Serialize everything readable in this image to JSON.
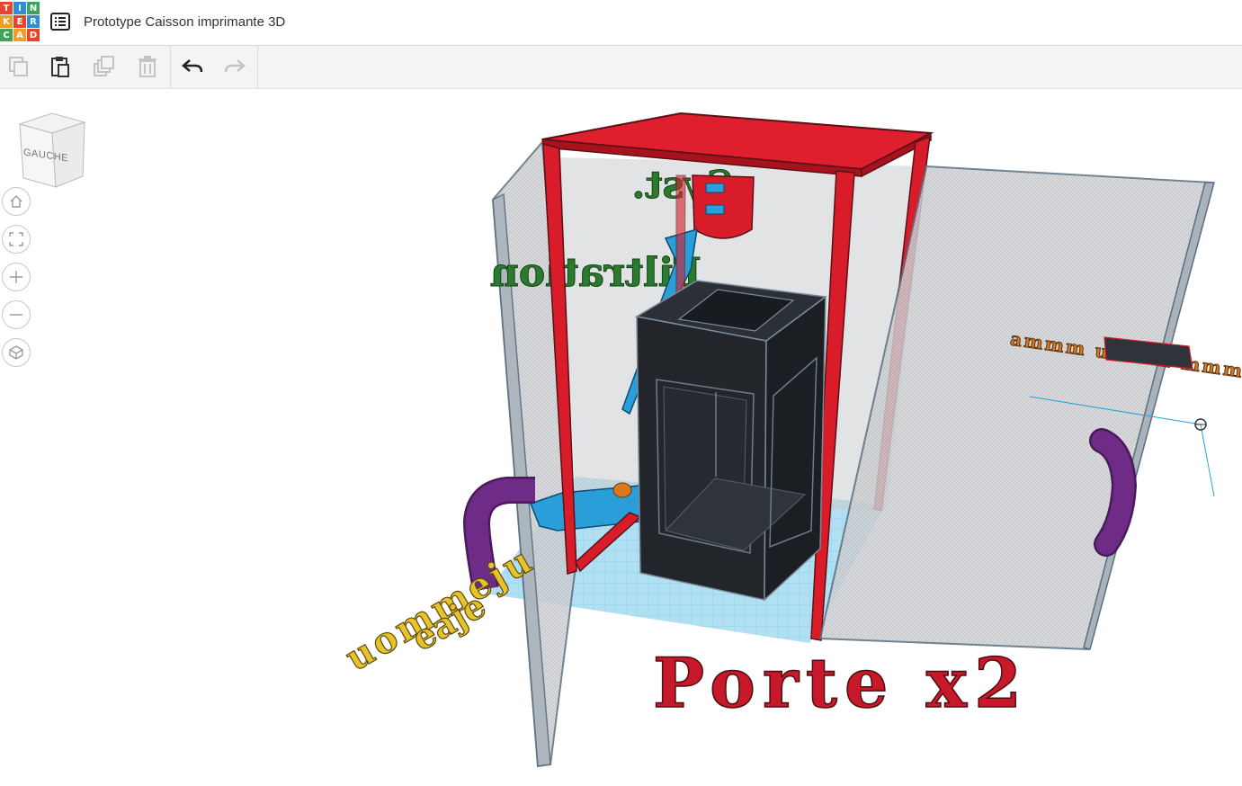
{
  "app": {
    "logo_letters": [
      "T",
      "I",
      "N",
      "K",
      "E",
      "R",
      "C",
      "A",
      "D"
    ],
    "logo_colors": [
      "#e8442d",
      "#2c8fd6",
      "#40a35a",
      "#f39c1f",
      "#e8442d",
      "#2c8fd6",
      "#40a35a",
      "#f39c1f",
      "#e8442d"
    ],
    "project_title": "Prototype Caisson imprimante 3D"
  },
  "toolbar": {
    "buttons": [
      {
        "name": "copy",
        "icon": "copy-icon",
        "enabled": false
      },
      {
        "name": "paste",
        "icon": "paste-icon",
        "enabled": true
      },
      {
        "name": "duplicate",
        "icon": "duplicate-icon",
        "enabled": false
      },
      {
        "name": "delete",
        "icon": "trash-icon",
        "enabled": false
      },
      {
        "name": "undo",
        "icon": "undo-icon",
        "enabled": true
      },
      {
        "name": "redo",
        "icon": "redo-icon",
        "enabled": false
      }
    ]
  },
  "viewcube": {
    "face_label": "GAUCHE"
  },
  "nav_controls": [
    {
      "name": "home-view",
      "icon": "home-icon"
    },
    {
      "name": "fit-view",
      "icon": "fit-view-icon"
    },
    {
      "name": "zoom-in",
      "icon": "plus-icon"
    },
    {
      "name": "zoom-out",
      "icon": "minus-icon"
    },
    {
      "name": "ortho-toggle",
      "icon": "cube-icon"
    }
  ],
  "scene": {
    "red_text_label": "Porte x2",
    "colors": {
      "frame_red": "#d91c2a",
      "printer_black": "#22262b",
      "panel_grey": "#c9cdd1",
      "workplane_blue": "#9fd6ef",
      "pipe_purple": "#6e2c86",
      "text_yellow": "#e8c22a",
      "text_green": "#2c7a2e",
      "text_orange": "#d9781e",
      "part_blue": "#2a9ed8"
    }
  }
}
